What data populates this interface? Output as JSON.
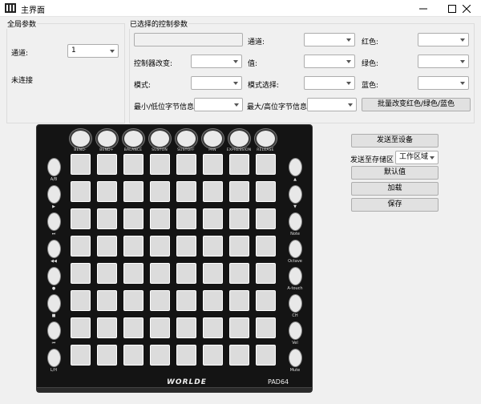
{
  "window": {
    "title": "主界面"
  },
  "global_params": {
    "title": "全局参数",
    "channel_label": "通道:",
    "channel_value": "1",
    "status_text": "未连接"
  },
  "selected_params": {
    "title": "已选择的控制参数",
    "channel_label": "通道:",
    "red_label": "红色:",
    "controller_change_label": "控制器改变:",
    "value_label": "值:",
    "green_label": "绿色:",
    "mode_label": "模式:",
    "mode_select_label": "模式选择:",
    "blue_label": "蓝色:",
    "min_label": "最小/低位字节信息:",
    "max_label": "最大/高位字节信息:",
    "batch_button": "批量改变红色/绿色/蓝色"
  },
  "actions": {
    "send_to_device": "发送至设备",
    "send_to_storage_label": "发送至存储区",
    "storage_value": "工作区域",
    "default": "默认值",
    "load": "加载",
    "save": "保存"
  },
  "device": {
    "knob_labels": [
      "BEND-",
      "BEND+",
      "BALANCE",
      "SUSTON",
      "SUSTOFF",
      "PAN",
      "EXPRESSION",
      "RELEASE"
    ],
    "left_labels": [
      "A/B",
      "▶",
      "⏭",
      "◀◀",
      "●",
      "■",
      "⏮",
      "L/H"
    ],
    "right_labels": [
      "▲",
      "▼",
      "Note",
      "Octave",
      "A-touch",
      "CH",
      "Vel",
      "Mute"
    ],
    "brand": "WORLDE",
    "model": "PAD64"
  }
}
